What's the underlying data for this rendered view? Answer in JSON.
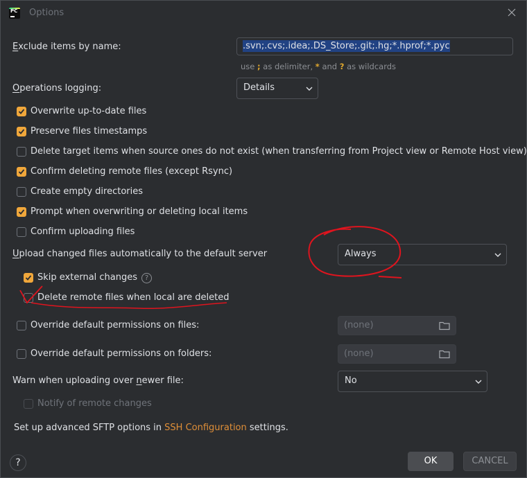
{
  "window": {
    "title": "Options",
    "app_icon_text": "PC"
  },
  "exclude": {
    "label_u": "E",
    "label_rest": "xclude items by name:",
    "value": ".svn;.cvs;.idea;.DS_Store;.git;.hg;*.hprof;*.pyc",
    "hint_use": "use",
    "hint_semicolon": ";",
    "hint_mid": "as delimiter,",
    "hint_star": "*",
    "hint_and": "and",
    "hint_q": "?",
    "hint_end": "as wildcards"
  },
  "ops_logging": {
    "label_u": "O",
    "label_rest": "perations logging:",
    "selected": "Details"
  },
  "checkboxes": [
    {
      "label": "Overwrite up-to-date files",
      "checked": true
    },
    {
      "label": "Preserve files timestamps",
      "checked": true
    },
    {
      "label": "Delete target items when source ones do not exist (when transferring from Project view or Remote Host view)",
      "checked": false
    },
    {
      "label": "Confirm deleting remote files (except Rsync)",
      "checked": true
    },
    {
      "label": "Create empty directories",
      "checked": false
    },
    {
      "label": "Prompt when overwriting or deleting local items",
      "checked": true
    },
    {
      "label": "Confirm uploading files",
      "checked": false
    }
  ],
  "upload": {
    "label_u": "U",
    "label_rest": "pload changed files automatically to the default server",
    "selected": "Always"
  },
  "skip_external": {
    "label": "Skip external changes",
    "checked": true
  },
  "help_mark": "?",
  "delete_remote": {
    "label": "Delete remote files when local are deleted",
    "checked": false
  },
  "perm_files": {
    "label": "Override default permissions on files:",
    "checked": false,
    "value": "(none)"
  },
  "perm_folders": {
    "label": "Override default permissions on folders:",
    "checked": false,
    "value": "(none)"
  },
  "warn": {
    "label_pre": "Warn when uploading over ",
    "label_u": "n",
    "label_rest": "ewer file:",
    "selected": "No"
  },
  "notify": {
    "label": "Notify of remote changes",
    "checked": false
  },
  "sftp": {
    "pre": "Set up advanced SFTP options in",
    "link": "SSH Configuration",
    "post": "settings."
  },
  "footer": {
    "help": "?",
    "ok": "OK",
    "cancel": "CANCEL"
  },
  "colors": {
    "accent_checkbox": "#f0a73b",
    "link": "#e08f38",
    "annotation": "#e0141e"
  }
}
